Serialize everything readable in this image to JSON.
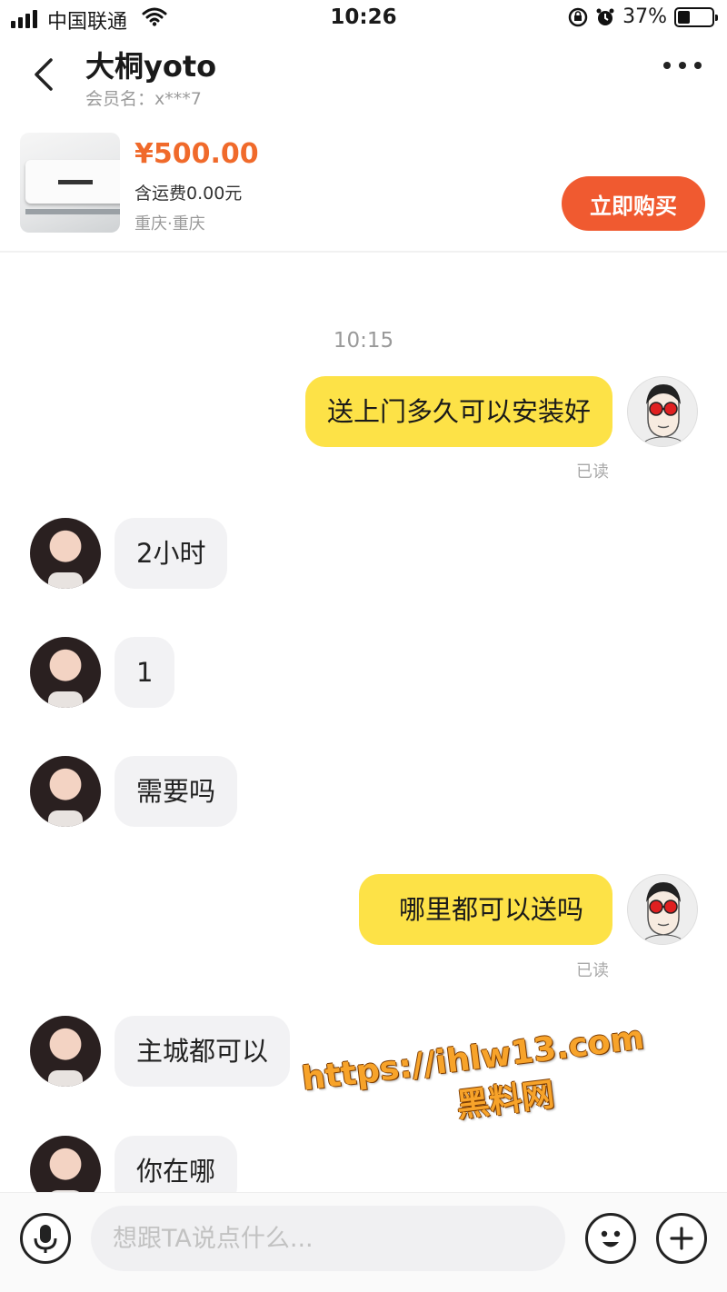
{
  "status_bar": {
    "carrier": "中国联通",
    "time": "10:26",
    "battery": "37%",
    "battery_level": 0.37,
    "icons": [
      "signal-icon",
      "wifi-icon",
      "orientation-lock-icon",
      "alarm-icon",
      "battery-icon"
    ]
  },
  "header": {
    "name": "大桐yoto",
    "member": "会员名：x***7",
    "back_icon": "chevron-left-icon",
    "more_icon": "more-dots-icon"
  },
  "product": {
    "price": "¥500.00",
    "shipping": "含运费0.00元",
    "location": "重庆·重庆",
    "buy_label": "立即购买"
  },
  "chat": {
    "timestamp": "10:15",
    "read_label": "已读",
    "messages": [
      {
        "from": "me",
        "text": "送上门多久可以安装好",
        "read": "已读"
      },
      {
        "from": "them",
        "text": "2小时"
      },
      {
        "from": "them",
        "text": "1"
      },
      {
        "from": "them",
        "text": "需要吗"
      },
      {
        "from": "me",
        "text": "哪里都可以送吗",
        "read": "已读"
      },
      {
        "from": "them",
        "text": "主城都可以"
      },
      {
        "from": "them",
        "text": "你在哪"
      }
    ]
  },
  "watermark": {
    "url": "https://ihlw13.com",
    "name": "黑料网"
  },
  "input_bar": {
    "placeholder": "想跟TA说点什么...",
    "icons": [
      "microphone-icon",
      "emoji-icon",
      "plus-icon"
    ]
  },
  "colors": {
    "accent_orange": "#f05a30",
    "price_orange": "#f06a2b",
    "my_bubble": "#fde247",
    "their_bubble": "#f2f2f4"
  }
}
